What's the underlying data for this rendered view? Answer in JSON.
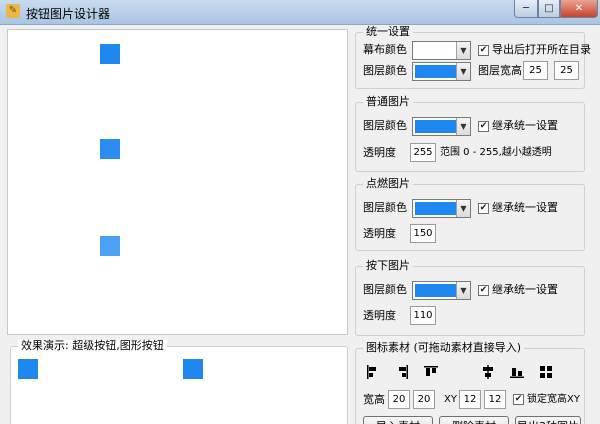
{
  "window": {
    "title": "按钮图片设计器",
    "min_glyph": "─",
    "max_glyph": "□",
    "close_glyph": "✕"
  },
  "canvas": {
    "layer_colors": [
      "#1e88f0",
      "#2a8cf0",
      "#4aa0f3"
    ]
  },
  "unified": {
    "title": "统一设置",
    "bg_color_label": "幕布颜色",
    "bg_color": "#ffffff",
    "layer_color_label": "图层颜色",
    "layer_color": "#1e88f0",
    "open_dir_label": "导出后打开所在目录",
    "open_dir_checked": true,
    "size_label": "图层宽高",
    "width": "25",
    "height": "25"
  },
  "normal": {
    "title": "普通图片",
    "layer_color_label": "图层颜色",
    "layer_color": "#1e88f0",
    "inherit_label": "继承统一设置",
    "inherit_checked": true,
    "opacity_label": "透明度",
    "opacity": "255",
    "range_note": "范围 0 - 255,越小越透明"
  },
  "hover": {
    "title": "点燃图片",
    "layer_color_label": "图层颜色",
    "layer_color": "#1e88f0",
    "inherit_label": "继承统一设置",
    "inherit_checked": true,
    "opacity_label": "透明度",
    "opacity": "150"
  },
  "pressed": {
    "title": "按下图片",
    "layer_color_label": "图层颜色",
    "layer_color": "#1e88f0",
    "inherit_label": "继承统一设置",
    "inherit_checked": true,
    "opacity_label": "透明度",
    "opacity": "110"
  },
  "preview": {
    "title": "效果演示: 超级按钮,图形按钮",
    "color": "#1e88f0"
  },
  "assets": {
    "title": "图标素材 (可拖动素材直接导入)",
    "icons": [
      "align-left-icon",
      "align-right-icon",
      "align-top-icon",
      "align-center-icon",
      "align-bottom-icon",
      "grid-icon"
    ],
    "size_label": "宽高",
    "w": "20",
    "h": "20",
    "xy_label": "XY",
    "x": "12",
    "y": "12",
    "lock_label": "锁定宽高XY",
    "lock_checked": true,
    "buttons": [
      "导入素材",
      "删除素材",
      "导出3种图片"
    ]
  }
}
